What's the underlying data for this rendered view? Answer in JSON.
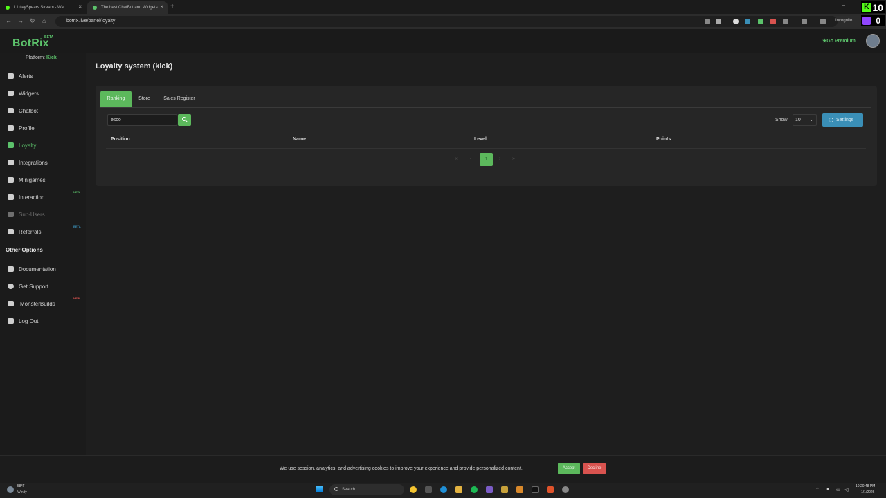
{
  "browser": {
    "tabs": [
      {
        "title": "L1ttleySpears Stream - Wat",
        "favicon_color": "#53fc18"
      },
      {
        "title": "The best ChatBot and Widgets",
        "favicon_color": "#5cc26b"
      }
    ],
    "url": "botrix.live/panel/loyalty",
    "incognito_label": "Incognito"
  },
  "overlay": {
    "kick_count": "10",
    "twitch_count": "0"
  },
  "app": {
    "logo": "BotRix",
    "logo_badge": "BETA",
    "platform_label": "Platform:",
    "platform_value": "Kick",
    "go_premium": "Go Premium",
    "accent_color": "#5cb85c"
  },
  "sidebar": {
    "items": [
      {
        "label": "Alerts",
        "icon": "bell-icon"
      },
      {
        "label": "Widgets",
        "icon": "widgets-icon"
      },
      {
        "label": "Chatbot",
        "icon": "chatbot-icon"
      },
      {
        "label": "Profile",
        "icon": "profile-icon"
      },
      {
        "label": "Loyalty",
        "icon": "gem-icon",
        "active": true
      },
      {
        "label": "Integrations",
        "icon": "integrations-icon"
      },
      {
        "label": "Minigames",
        "icon": "gamepad-icon"
      },
      {
        "label": "Interaction",
        "icon": "music-icon",
        "tag": "NEW"
      },
      {
        "label": "Sub-Users",
        "icon": "users-icon",
        "disabled": true
      },
      {
        "label": "Referrals",
        "icon": "referrals-icon",
        "tag": "BETA"
      }
    ],
    "other_heading": "Other Options",
    "other_items": [
      {
        "label": "Documentation",
        "icon": "book-icon"
      },
      {
        "label": "Get Support",
        "icon": "support-icon"
      },
      {
        "label": "MonsterBuilds",
        "icon": "laptop-icon",
        "tag": "NEW"
      },
      {
        "label": "Log Out",
        "icon": "logout-icon"
      }
    ]
  },
  "page": {
    "title": "Loyalty system (kick)",
    "tabs": [
      "Ranking",
      "Store",
      "Sales Register"
    ],
    "search_value": "esco",
    "show_label": "Show:",
    "show_value": "10",
    "settings_label": "Settings",
    "table_headers": [
      "Position",
      "Name",
      "Level",
      "Points"
    ],
    "pagination": {
      "first": "«",
      "prev": "‹",
      "current": "1",
      "next": "›",
      "last": "»"
    }
  },
  "cookie": {
    "text": "We use session, analytics, and advertising cookies to improve your experience and provide personalized content.",
    "accept": "Accept",
    "decline": "Decline"
  },
  "taskbar": {
    "weather_temp": "58°F",
    "weather_cond": "Windy",
    "search_placeholder": "Search",
    "time": "10:20:48 PM",
    "date": "1/1/2026"
  }
}
